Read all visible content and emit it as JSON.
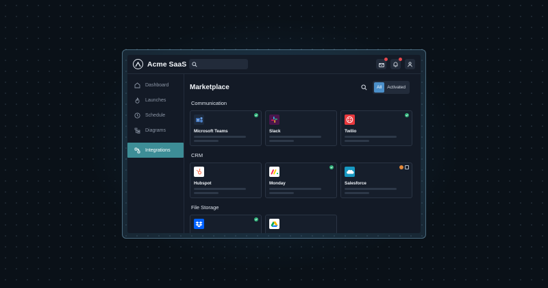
{
  "app": {
    "name": "Acme SaaS"
  },
  "search": {
    "placeholder": "",
    "value": ""
  },
  "sidebar": {
    "items": [
      {
        "label": "Dashboard",
        "icon": "home-icon"
      },
      {
        "label": "Launches",
        "icon": "flame-icon"
      },
      {
        "label": "Schedule",
        "icon": "clock-icon"
      },
      {
        "label": "Diagrams",
        "icon": "tree-icon"
      },
      {
        "label": "Integrations",
        "icon": "integrations-icon",
        "active": true
      }
    ]
  },
  "main": {
    "title": "Marketplace",
    "filters": [
      {
        "label": "All",
        "active": true
      },
      {
        "label": "Activated",
        "active": false
      }
    ],
    "sections": [
      {
        "title": "Communication",
        "cards": [
          {
            "name": "Microsoft Teams",
            "icon": "teams-icon",
            "status": "activated"
          },
          {
            "name": "Slack",
            "icon": "slack-icon",
            "status": "none"
          },
          {
            "name": "Twilio",
            "icon": "twilio-icon",
            "status": "activated"
          }
        ]
      },
      {
        "title": "CRM",
        "cards": [
          {
            "name": "Hubspot",
            "icon": "hubspot-icon",
            "status": "none"
          },
          {
            "name": "Monday",
            "icon": "monday-icon",
            "status": "activated"
          },
          {
            "name": "Salesforce",
            "icon": "salesforce-icon",
            "status": "error"
          }
        ]
      },
      {
        "title": "File Storage",
        "cards": [
          {
            "name": "",
            "icon": "dropbox-icon",
            "status": "activated"
          },
          {
            "name": "",
            "icon": "google-drive-icon",
            "status": "none"
          }
        ]
      }
    ]
  },
  "colors": {
    "accent": "#3d8d96",
    "filter_active": "#4b8fc9",
    "activated": "#2fb37a",
    "notification": "#e5484d"
  }
}
